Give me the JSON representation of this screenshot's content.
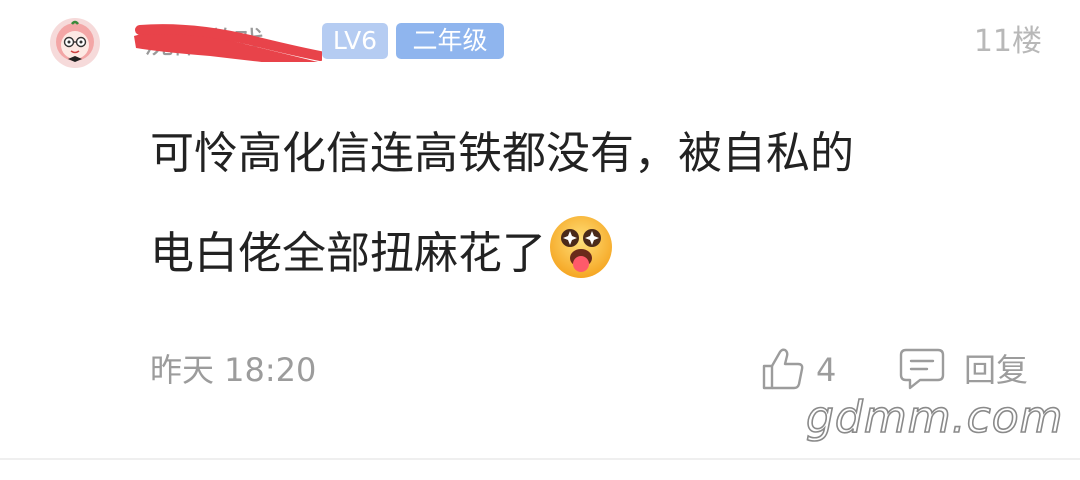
{
  "comment": {
    "username": "沈阳游戏",
    "level_badge": "LV6",
    "grade_badge": "二年级",
    "floor": "11楼",
    "content_lines": [
      "可怜高化信连高铁都没有，被自私的",
      "电白佬全部扭麻花了"
    ],
    "emoji_icon": "star-eyes-tongue-emoji",
    "timestamp": "昨天 18:20",
    "like_count": "4",
    "reply_label": "回复"
  },
  "watermark": "gdmm.com",
  "colors": {
    "badge_level": "#b5ccf2",
    "badge_grade": "#8fb5ee",
    "redaction": "#e8434a",
    "meta_text": "#9c9c9c",
    "content_text": "#222222"
  }
}
